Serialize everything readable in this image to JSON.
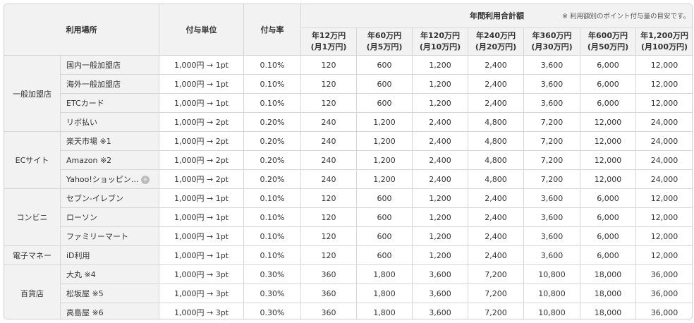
{
  "header": {
    "place": "利用場所",
    "unit": "付与単位",
    "rate": "付与率",
    "total_title": "年間利用合計額",
    "note": "※ 利用額別のポイント付与量の目安です。",
    "amounts": [
      {
        "line1": "年12万円",
        "line2": "(月1万円)"
      },
      {
        "line1": "年60万円",
        "line2": "(月5万円)"
      },
      {
        "line1": "年120万円",
        "line2": "(月10万円)"
      },
      {
        "line1": "年240万円",
        "line2": "(月20万円)"
      },
      {
        "line1": "年360万円",
        "line2": "(月30万円)"
      },
      {
        "line1": "年600万円",
        "line2": "(月50万円)"
      },
      {
        "line1": "年1,200万円",
        "line2": "(月100万円)"
      }
    ]
  },
  "categories": [
    {
      "name": "一般加盟店",
      "rows": [
        {
          "place": "国内一般加盟店",
          "unit": "1,000円 → 1pt",
          "rate": "0.10%",
          "values": [
            "120",
            "600",
            "1,200",
            "2,400",
            "3,600",
            "6,000",
            "12,000"
          ]
        },
        {
          "place": "海外一般加盟店",
          "unit": "1,000円 → 1pt",
          "rate": "0.10%",
          "values": [
            "120",
            "600",
            "1,200",
            "2,400",
            "3,600",
            "6,000",
            "12,000"
          ]
        },
        {
          "place": "ETCカード",
          "unit": "1,000円 → 1pt",
          "rate": "0.10%",
          "values": [
            "120",
            "600",
            "1,200",
            "2,400",
            "3,600",
            "6,000",
            "12,000"
          ]
        },
        {
          "place": "リボ払い",
          "unit": "1,000円 → 2pt",
          "rate": "0.20%",
          "values": [
            "240",
            "1,200",
            "2,400",
            "4,800",
            "7,200",
            "12,000",
            "24,000"
          ]
        }
      ]
    },
    {
      "name": "ECサイト",
      "rows": [
        {
          "place": "楽天市場 ※1",
          "unit": "1,000円 → 2pt",
          "rate": "0.20%",
          "values": [
            "240",
            "1,200",
            "2,400",
            "4,800",
            "7,200",
            "12,000",
            "24,000"
          ]
        },
        {
          "place": "Amazon ※2",
          "unit": "1,000円 → 2pt",
          "rate": "0.20%",
          "values": [
            "240",
            "1,200",
            "2,400",
            "4,800",
            "7,200",
            "12,000",
            "24,000"
          ]
        },
        {
          "place": "Yahoo!ショッピン…",
          "unit": "1,000円 → 2pt",
          "rate": "0.20%",
          "values": [
            "240",
            "1,200",
            "2,400",
            "4,800",
            "7,200",
            "12,000",
            "24,000"
          ],
          "icon": "info-icon"
        }
      ]
    },
    {
      "name": "コンビニ",
      "rows": [
        {
          "place": "セブン-イレブン",
          "unit": "1,000円 → 1pt",
          "rate": "0.10%",
          "values": [
            "120",
            "600",
            "1,200",
            "2,400",
            "3,600",
            "6,000",
            "12,000"
          ]
        },
        {
          "place": "ローソン",
          "unit": "1,000円 → 1pt",
          "rate": "0.10%",
          "values": [
            "120",
            "600",
            "1,200",
            "2,400",
            "3,600",
            "6,000",
            "12,000"
          ]
        },
        {
          "place": "ファミリーマート",
          "unit": "1,000円 → 1pt",
          "rate": "0.10%",
          "values": [
            "120",
            "600",
            "1,200",
            "2,400",
            "3,600",
            "6,000",
            "12,000"
          ]
        }
      ]
    },
    {
      "name": "電子マネー",
      "rows": [
        {
          "place": "iD利用",
          "unit": "1,000円 → 1pt",
          "rate": "0.10%",
          "values": [
            "120",
            "600",
            "1,200",
            "2,400",
            "3,600",
            "6,000",
            "12,000"
          ]
        }
      ]
    },
    {
      "name": "百貨店",
      "rows": [
        {
          "place": "大丸 ※4",
          "unit": "1,000円 → 3pt",
          "rate": "0.30%",
          "values": [
            "360",
            "1,800",
            "3,600",
            "7,200",
            "10,800",
            "18,000",
            "36,000"
          ]
        },
        {
          "place": "松坂屋 ※5",
          "unit": "1,000円 → 3pt",
          "rate": "0.30%",
          "values": [
            "360",
            "1,800",
            "3,600",
            "7,200",
            "10,800",
            "18,000",
            "36,000"
          ]
        },
        {
          "place": "高島屋 ※6",
          "unit": "1,000円 → 3pt",
          "rate": "0.30%",
          "values": [
            "360",
            "1,800",
            "3,600",
            "7,200",
            "10,800",
            "18,000",
            "36,000"
          ]
        }
      ]
    }
  ]
}
